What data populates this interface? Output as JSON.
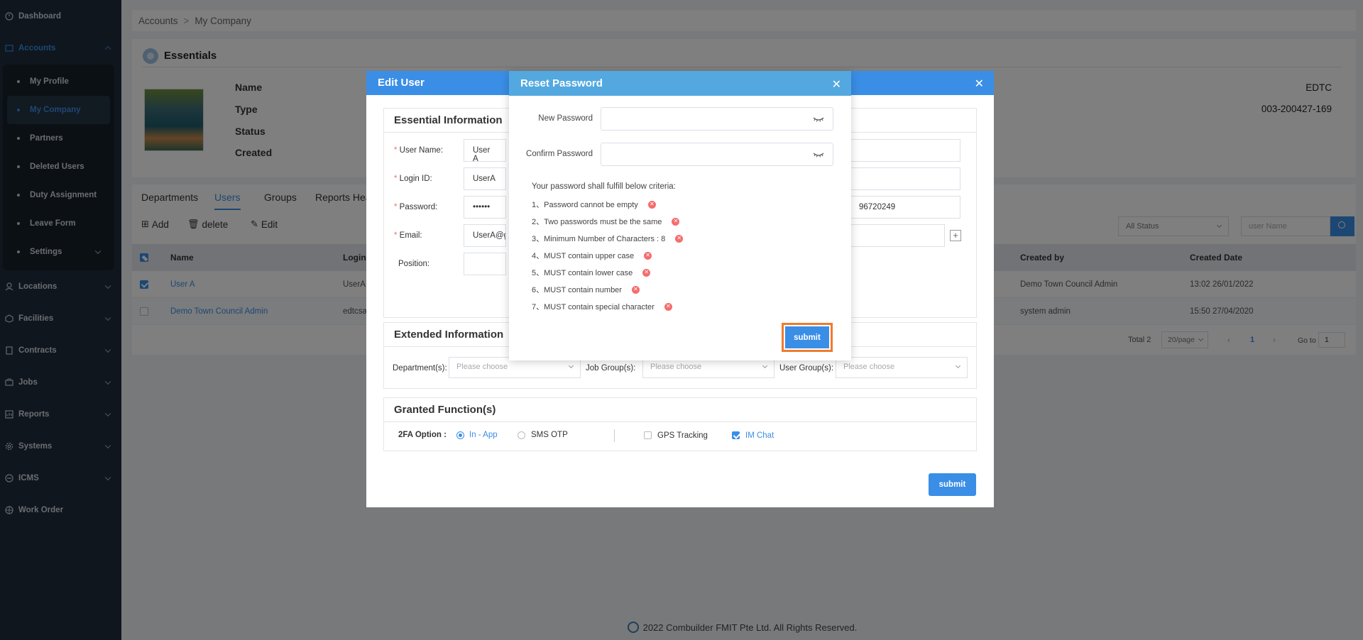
{
  "sidebar": {
    "dashboard": "Dashboard",
    "accounts": "Accounts",
    "sub": [
      "My Profile",
      "My Company",
      "Partners",
      "Deleted Users",
      "Duty Assignment",
      "Leave Form",
      "Settings"
    ],
    "locations": "Locations",
    "facilities": "Facilities",
    "contracts": "Contracts",
    "jobs": "Jobs",
    "reports": "Reports",
    "systems": "Systems",
    "icms": "ICMS",
    "work_order": "Work Order"
  },
  "breadcrumb": {
    "root": "Accounts",
    "current": "My Company"
  },
  "essentials": {
    "title": "Essentials",
    "labels": {
      "name": "Name",
      "type": "Type",
      "status": "Status",
      "created": "Created"
    },
    "values": {
      "name": "EDTC",
      "type": "003-200427-169"
    }
  },
  "tabs": [
    "Departments",
    "Users",
    "Groups",
    "Reports Hea"
  ],
  "toolbar": {
    "add": "Add",
    "delete": "delete",
    "edit": "Edit"
  },
  "filters": {
    "status": "All Status",
    "user_placeholder": "user Name"
  },
  "table": {
    "headers": {
      "name": "Name",
      "login": "Login",
      "created_by": "Created by",
      "created_date": "Created Date"
    },
    "rows": [
      {
        "name": "User A",
        "login": "UserA",
        "created_by": "Demo Town Council Admin",
        "created_date": "13:02 26/01/2022"
      },
      {
        "name": "Demo Town Council Admin",
        "login": "edtcsa",
        "created_by": "system admin",
        "created_date": "15:50 27/04/2020"
      }
    ]
  },
  "pagination": {
    "total": "Total 2",
    "per_page": "20/page",
    "page": "1",
    "goto_label": "Go to",
    "goto_value": "1"
  },
  "edit_user": {
    "title": "Edit User",
    "essential_title": "Essential Information",
    "user_name_label": "User Name:",
    "user_name": "User A",
    "login_id_label": "Login ID:",
    "login_id": "UserA",
    "password_label": "Password:",
    "password": "••••••",
    "phone_partial": "96720249",
    "email_label": "Email:",
    "email": "UserA@gr",
    "position_label": "Position:",
    "extended_title": "Extended Information",
    "department_label": "Department(s):",
    "job_group_label": "Job Group(s):",
    "user_group_label": "User Group(s):",
    "please_choose": "Please choose",
    "granted_title": "Granted Function(s)",
    "twofa_label": "2FA Option :",
    "twofa_inapp": "In - App",
    "twofa_sms": "SMS OTP",
    "gps": "GPS Tracking",
    "im_chat": "IM Chat",
    "submit": "submit"
  },
  "reset_password": {
    "title": "Reset Password",
    "new_label": "New Password",
    "confirm_label": "Confirm Password",
    "criteria_title": "Your password shall fulfill below criteria:",
    "criteria": [
      "1、Password cannot be empty",
      "2、Two passwords must be the same",
      "3、Minimum Number of Characters : 8",
      "4、MUST contain upper case",
      "5、MUST contain lower case",
      "6、MUST contain number",
      "7、MUST contain special character"
    ],
    "submit": "submit"
  },
  "footer": {
    "text": "2022 Combuilder FMIT Pte Ltd. All Rights Reserved."
  },
  "colors": {
    "primary": "#3a8ee6",
    "sidebar": "#1f2d3d",
    "error": "#f56c6c",
    "highlight": "#f07b2c"
  }
}
